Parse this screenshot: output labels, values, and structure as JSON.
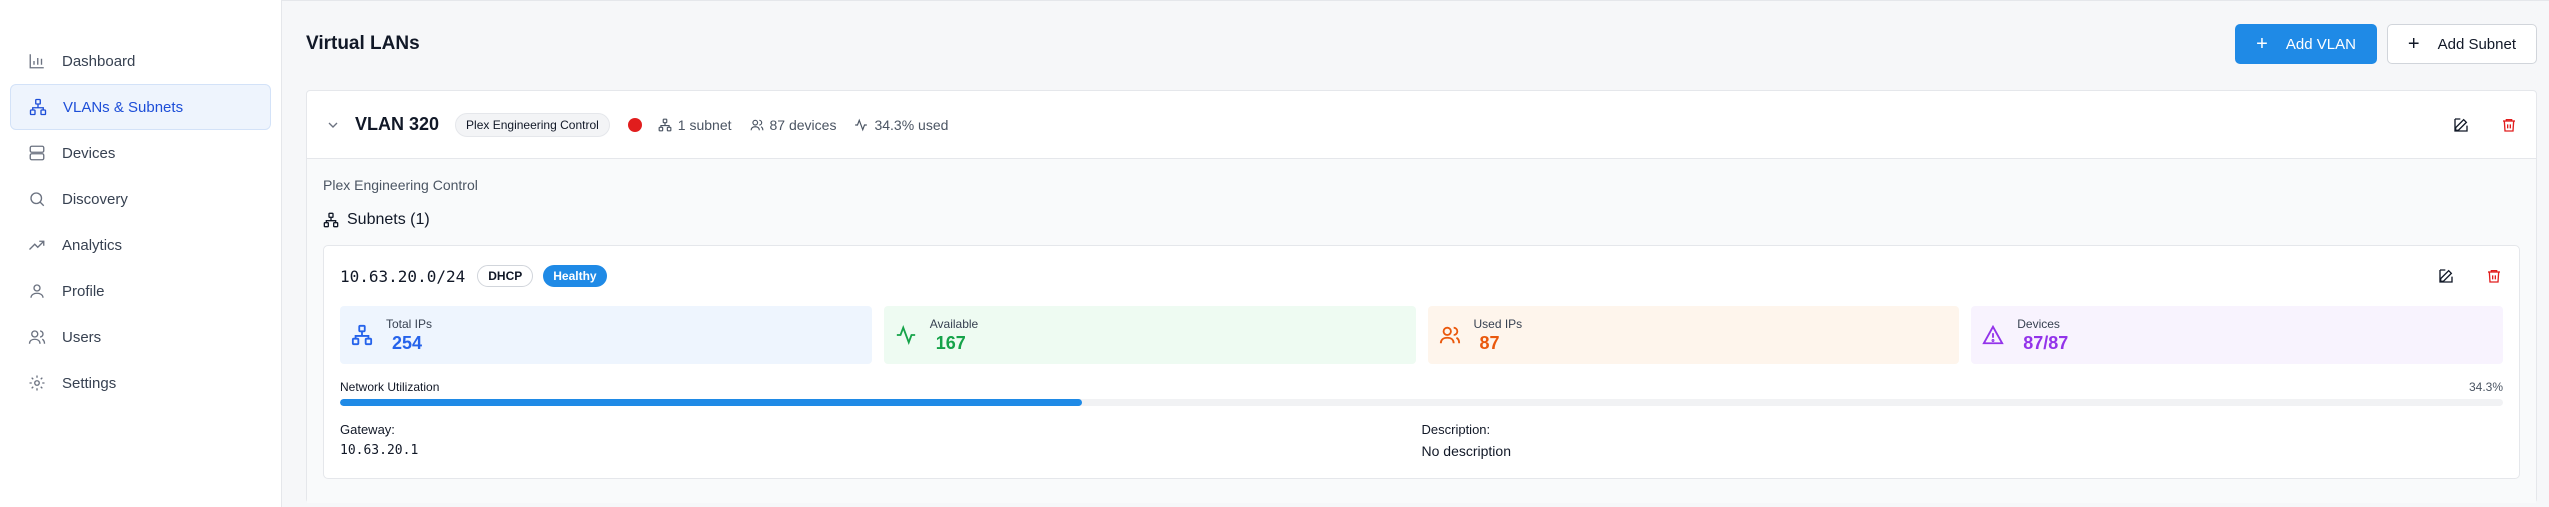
{
  "sidebar": {
    "items": [
      {
        "label": "Dashboard",
        "icon": "bar-chart-icon",
        "active": false
      },
      {
        "label": "VLANs & Subnets",
        "icon": "network-icon",
        "active": true
      },
      {
        "label": "Devices",
        "icon": "server-icon",
        "active": false
      },
      {
        "label": "Discovery",
        "icon": "search-icon",
        "active": false
      },
      {
        "label": "Analytics",
        "icon": "trending-up-icon",
        "active": false
      },
      {
        "label": "Profile",
        "icon": "user-icon",
        "active": false
      },
      {
        "label": "Users",
        "icon": "users-icon",
        "active": false
      },
      {
        "label": "Settings",
        "icon": "gear-icon",
        "active": false
      }
    ]
  },
  "header": {
    "title": "Virtual LANs",
    "add_vlan_label": "Add VLAN",
    "add_subnet_label": "Add Subnet"
  },
  "vlan": {
    "name": "VLAN 320",
    "tag": "Plex Engineering Control",
    "status_color": "#e11d1d",
    "subnet_count": "1 subnet",
    "device_count": "87 devices",
    "usage": "34.3% used",
    "description": "Plex Engineering Control",
    "subnets_title": "Subnets (1)"
  },
  "subnet": {
    "cidr": "10.63.20.0/24",
    "dhcp_tag": "DHCP",
    "health_tag": "Healthy",
    "stats": {
      "total_label": "Total IPs",
      "total_value": "254",
      "available_label": "Available",
      "available_value": "167",
      "used_label": "Used IPs",
      "used_value": "87",
      "devices_label": "Devices",
      "devices_value": "87/87"
    },
    "utilization_label": "Network Utilization",
    "utilization_text": "34.3%",
    "utilization_percent": 34.3,
    "gateway_label": "Gateway:",
    "gateway_value": "10.63.20.1",
    "description_label": "Description:",
    "description_value": "No description"
  },
  "colors": {
    "accent": "#1f8ae6",
    "danger": "#e11d1d"
  }
}
